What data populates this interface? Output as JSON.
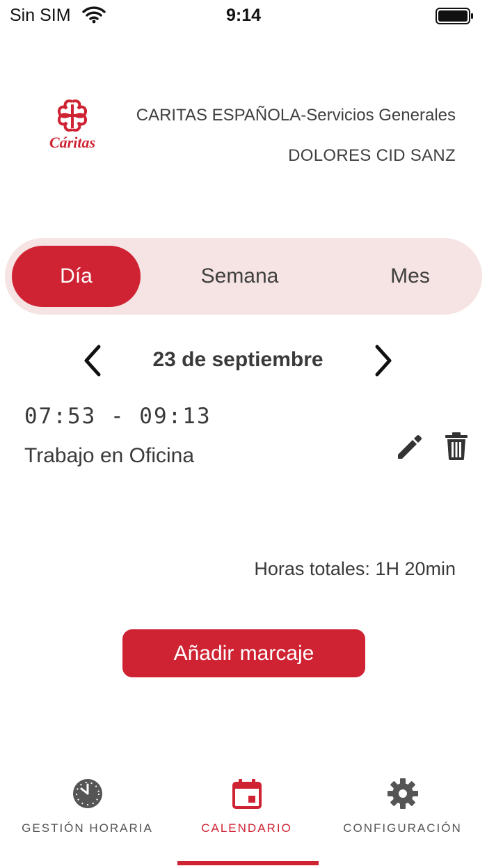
{
  "status_bar": {
    "carrier": "Sin SIM",
    "time": "9:14"
  },
  "header": {
    "logo_text": "Cáritas",
    "organization": "CARITAS ESPAÑOLA-Servicios Generales",
    "user": "DOLORES CID SANZ"
  },
  "view_selector": {
    "options": [
      "Día",
      "Semana",
      "Mes"
    ],
    "selected": "Día"
  },
  "date_nav": {
    "date": "23 de septiembre"
  },
  "entries": [
    {
      "time_range": "07:53 - 09:13",
      "type": "Trabajo en Oficina"
    }
  ],
  "total_hours": "Horas totales: 1H 20min",
  "add_button": "Añadir marcaje",
  "tabs": [
    {
      "label": "GESTIÓN HORARIA",
      "icon": "clock-icon"
    },
    {
      "label": "CALENDARIO",
      "icon": "calendar-icon",
      "active": true
    },
    {
      "label": "CONFIGURACIÓN",
      "icon": "gear-icon"
    }
  ],
  "colors": {
    "brand": "#cf2333",
    "segment_bg": "#f6e3e3",
    "text": "#3a3a3a"
  }
}
